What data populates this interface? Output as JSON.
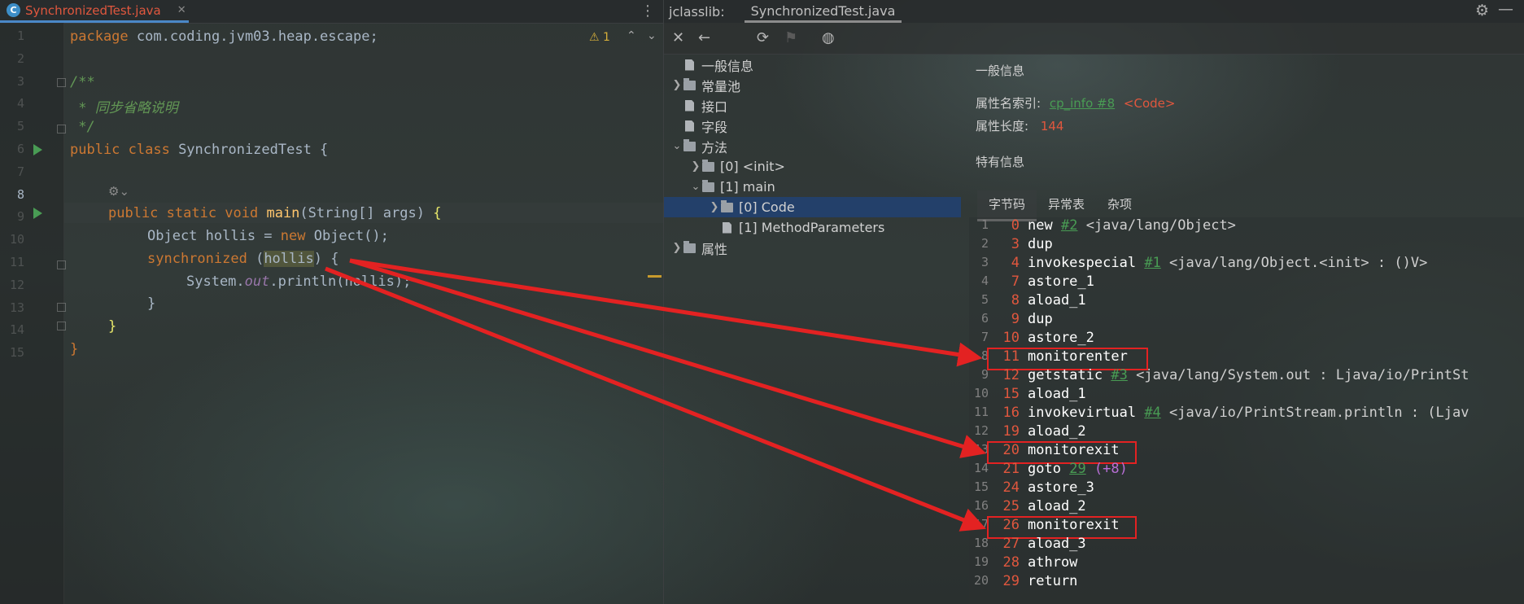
{
  "editor": {
    "tab_label": "SynchronizedTest.java",
    "tab_close": "✕",
    "warning_count": "1",
    "lines": [
      {
        "n": "1"
      },
      {
        "n": "2"
      },
      {
        "n": "3"
      },
      {
        "n": "4"
      },
      {
        "n": "5"
      },
      {
        "n": "6"
      },
      {
        "n": "7"
      },
      {
        "n": "8"
      },
      {
        "n": "9"
      },
      {
        "n": "10"
      },
      {
        "n": "11"
      },
      {
        "n": "12"
      },
      {
        "n": "13"
      },
      {
        "n": "14"
      },
      {
        "n": "15"
      }
    ],
    "code": {
      "l1_kw": "package",
      "l1_rest": " com.coding.jvm03.heap.escape;",
      "l3": "/**",
      "l4": " * 同步省略说明",
      "l5": " */",
      "l6_kw": "public class",
      "l6_name": " SynchronizedTest {",
      "l8_kw": "public static void",
      "l8_fn": " main",
      "l8_args": "(String[] args) ",
      "l8_brace": "{",
      "l9_a": "Object hollis = ",
      "l9_kw": "new",
      "l9_b": " Object();",
      "l10_kw": "synchronized",
      "l10_a": " (",
      "l10_var": "hollis",
      "l10_b": ") {",
      "l11_a": "System.",
      "l11_out": "out",
      "l11_b": ".println(hollis);",
      "l12": "}",
      "l13": "}",
      "l14": "}"
    }
  },
  "panel": {
    "title": "jclasslib:",
    "tab": "SynchronizedTest.java",
    "tree": [
      {
        "label": "一般信息"
      },
      {
        "label": "常量池"
      },
      {
        "label": "接口"
      },
      {
        "label": "字段"
      },
      {
        "label": "方法"
      },
      {
        "label": "[0] <init>"
      },
      {
        "label": "[1] main"
      },
      {
        "label": "[0] Code"
      },
      {
        "label": "[1] MethodParameters"
      },
      {
        "label": "属性"
      }
    ],
    "general_title": "一般信息",
    "attr_name_label": "属性名索引:",
    "attr_name_link": "cp_info #8",
    "attr_name_value": "<Code>",
    "attr_len_label": "属性长度:",
    "attr_len_value": "144",
    "specific_title": "特有信息",
    "subtabs": [
      "字节码",
      "异常表",
      "杂项"
    ],
    "bytecode": [
      {
        "n": "1",
        "off": "0",
        "ins": "new",
        "ref": "#2",
        "arg": " <java/lang/Object>"
      },
      {
        "n": "2",
        "off": "3",
        "ins": "dup",
        "ref": "",
        "arg": ""
      },
      {
        "n": "3",
        "off": "4",
        "ins": "invokespecial",
        "ref": "#1",
        "arg": " <java/lang/Object.<init> : ()V>"
      },
      {
        "n": "4",
        "off": "7",
        "ins": "astore_1",
        "ref": "",
        "arg": ""
      },
      {
        "n": "5",
        "off": "8",
        "ins": "aload_1",
        "ref": "",
        "arg": ""
      },
      {
        "n": "6",
        "off": "9",
        "ins": "dup",
        "ref": "",
        "arg": ""
      },
      {
        "n": "7",
        "off": "10",
        "ins": "astore_2",
        "ref": "",
        "arg": ""
      },
      {
        "n": "8",
        "off": "11",
        "ins": "monitorenter",
        "ref": "",
        "arg": ""
      },
      {
        "n": "9",
        "off": "12",
        "ins": "getstatic",
        "ref": "#3",
        "arg": " <java/lang/System.out : Ljava/io/PrintSt"
      },
      {
        "n": "10",
        "off": "15",
        "ins": "aload_1",
        "ref": "",
        "arg": ""
      },
      {
        "n": "11",
        "off": "16",
        "ins": "invokevirtual",
        "ref": "#4",
        "arg": " <java/io/PrintStream.println : (Ljav"
      },
      {
        "n": "12",
        "off": "19",
        "ins": "aload_2",
        "ref": "",
        "arg": ""
      },
      {
        "n": "13",
        "off": "20",
        "ins": "monitorexit",
        "ref": "",
        "arg": ""
      },
      {
        "n": "14",
        "off": "21",
        "ins": "goto",
        "ref": "29",
        "arg": " (+8)"
      },
      {
        "n": "15",
        "off": "24",
        "ins": "astore_3",
        "ref": "",
        "arg": ""
      },
      {
        "n": "16",
        "off": "25",
        "ins": "aload_2",
        "ref": "",
        "arg": ""
      },
      {
        "n": "17",
        "off": "26",
        "ins": "monitorexit",
        "ref": "",
        "arg": ""
      },
      {
        "n": "18",
        "off": "27",
        "ins": "aload_3",
        "ref": "",
        "arg": ""
      },
      {
        "n": "19",
        "off": "28",
        "ins": "athrow",
        "ref": "",
        "arg": ""
      },
      {
        "n": "20",
        "off": "29",
        "ins": "return",
        "ref": "",
        "arg": ""
      }
    ]
  }
}
